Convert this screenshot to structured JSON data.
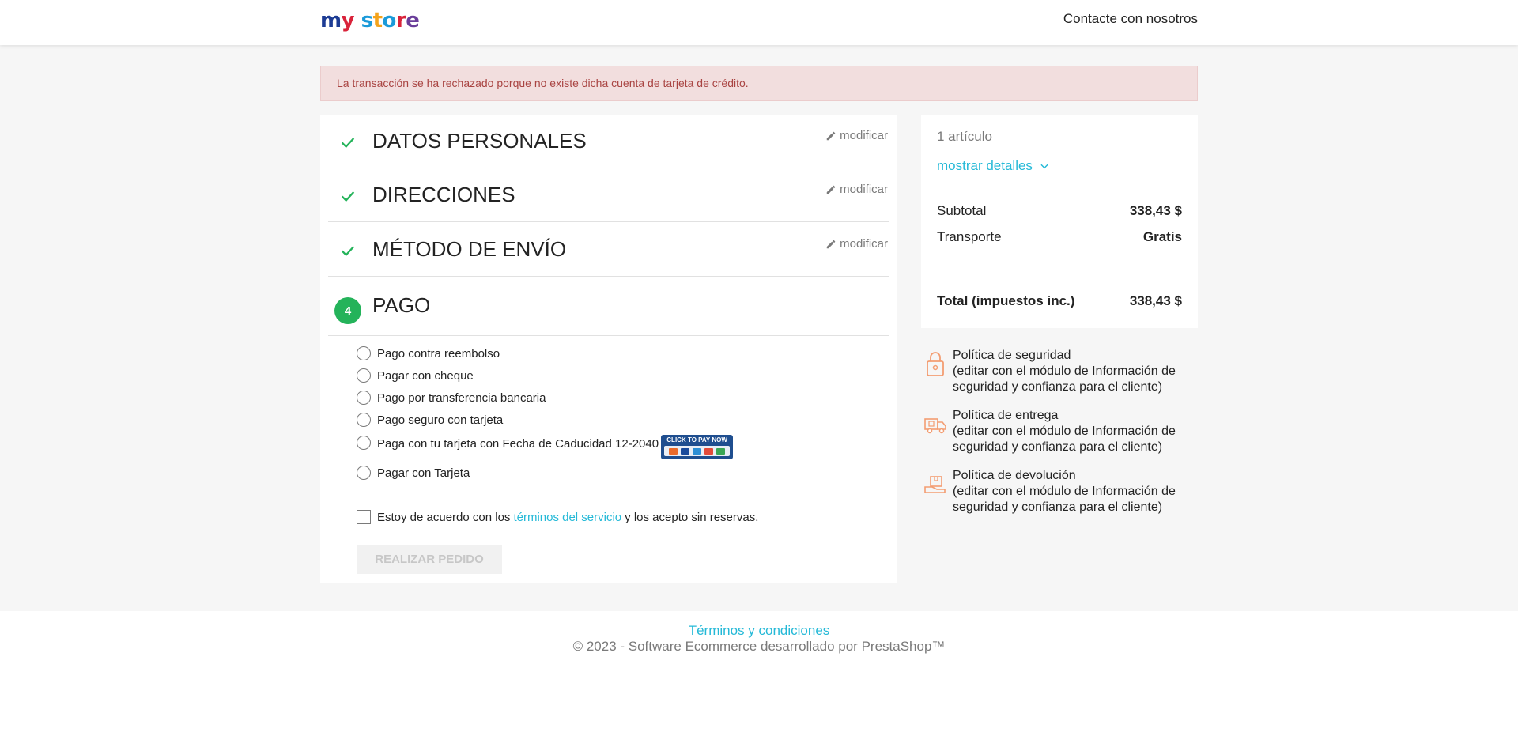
{
  "header": {
    "logo_parts": [
      "m",
      "y",
      " ",
      "s",
      "t",
      "o",
      "r",
      "e"
    ],
    "contact_label": "Contacte con nosotros"
  },
  "alert": {
    "message": "La transacción se ha rechazado porque no existe dicha cuenta de tarjeta de crédito."
  },
  "steps": [
    {
      "title": "DATOS PERSONALES",
      "edit_label": "modificar",
      "done": true
    },
    {
      "title": "DIRECCIONES",
      "edit_label": "modificar",
      "done": true
    },
    {
      "title": "MÉTODO DE ENVÍO",
      "edit_label": "modificar",
      "done": true
    },
    {
      "title": "PAGO",
      "number": "4",
      "done": false
    }
  ],
  "payment_options": [
    {
      "label": "Pago contra reembolso"
    },
    {
      "label": "Pagar con cheque"
    },
    {
      "label": "Pago por transferencia bancaria"
    },
    {
      "label": "Pago seguro con tarjeta"
    },
    {
      "label": "Paga con tu tarjeta con Fecha de Caducidad 12-2040",
      "badge": "CLICK TO PAY NOW"
    },
    {
      "label": "Pagar con Tarjeta"
    }
  ],
  "terms": {
    "before": "Estoy de acuerdo con los",
    "link": "términos del servicio",
    "after": "y los acepto sin reservas."
  },
  "order_button": "REALIZAR PEDIDO",
  "summary": {
    "items_count": "1 artículo",
    "show_details": "mostrar detalles",
    "subtotal_label": "Subtotal",
    "subtotal_value": "338,43 $",
    "shipping_label": "Transporte",
    "shipping_value": "Gratis",
    "total_label": "Total (impuestos inc.)",
    "total_value": "338,43 $"
  },
  "reassurance": [
    {
      "title": "Política de seguridad",
      "desc": "(editar con el módulo de Información de seguridad y confianza para el cliente)",
      "icon": "lock-icon"
    },
    {
      "title": "Política de entrega",
      "desc": "(editar con el módulo de Información de seguridad y confianza para el cliente)",
      "icon": "delivery-truck-icon"
    },
    {
      "title": "Política de devolución",
      "desc": "(editar con el módulo de Información de seguridad y confianza para el cliente)",
      "icon": "return-package-icon"
    }
  ],
  "footer": {
    "terms_link": "Términos y condiciones",
    "copyright": "© 2023 - Software Ecommerce desarrollado por PrestaShop™"
  },
  "colors": {
    "accent": "#24b9d7",
    "success": "#24b35a",
    "alert_bg": "#f2dede",
    "alert_text": "#a94442",
    "reassurance_icon": "#f39d72"
  }
}
